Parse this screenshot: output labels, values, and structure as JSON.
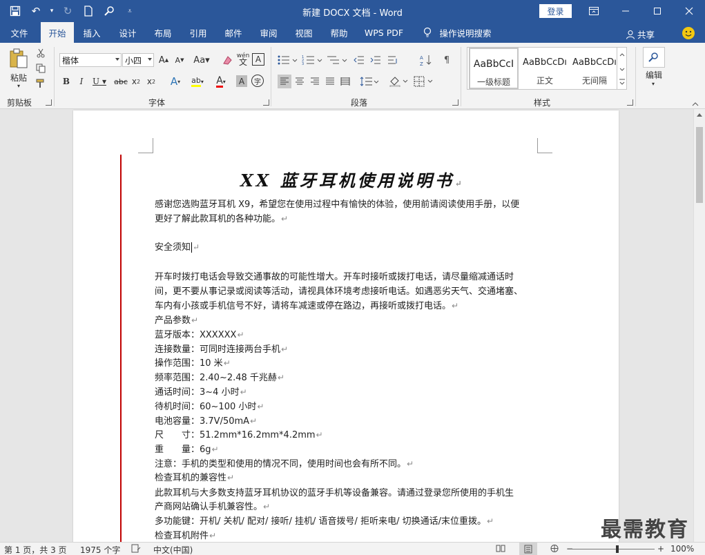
{
  "window": {
    "title": "新建 DOCX 文档 - Word",
    "login_label": "登录",
    "controls": [
      "🗗",
      "─",
      "☐",
      "✕"
    ]
  },
  "qat": {
    "icons": [
      "save-icon",
      "undo-icon",
      "redo-icon",
      "new-doc-icon",
      "touch-mode-icon",
      "customize-icon"
    ]
  },
  "tabs": [
    "文件",
    "开始",
    "插入",
    "设计",
    "布局",
    "引用",
    "邮件",
    "审阅",
    "视图",
    "帮助",
    "WPS PDF"
  ],
  "active_tab": "开始",
  "tell_me": "操作说明搜索",
  "share_label": "共享",
  "ribbon": {
    "clipboard": {
      "paste_label": "粘贴",
      "group_label": "剪贴板"
    },
    "font": {
      "font_name": "楷体",
      "font_size": "小四",
      "group_label": "字体",
      "buttons": [
        "A^",
        "Aˇ",
        "Aa",
        "B",
        "I",
        "U",
        "abc",
        "x₂",
        "x²",
        "A",
        "ab",
        "A",
        "A",
        "字"
      ]
    },
    "paragraph": {
      "group_label": "段落"
    },
    "styles": {
      "group_label": "样式",
      "items": [
        {
          "sample": "AaBbCcI",
          "name": "一级标题"
        },
        {
          "sample": "AaBbCcDı",
          "name": "正文"
        },
        {
          "sample": "AaBbCcDı",
          "name": "无间隔"
        }
      ]
    },
    "editing": {
      "label": "编辑"
    }
  },
  "document": {
    "heading": "XX 蓝牙耳机使用说明书",
    "lines": [
      {
        "text": "感谢您选购蓝牙耳机 X9，希望您在使用过程中有愉快的体验，使用前请阅读使用手册，以便",
        "pmark": ""
      },
      {
        "text": "更好了解此款耳机的各种功能。",
        "pmark": "↵"
      },
      {
        "text": "安全须知",
        "pmark": "↵"
      },
      {
        "text": "开车时拨打电话会导致交通事故的可能性增大。开车时接听或拨打电话，请尽量缩减通话时",
        "pmark": ""
      },
      {
        "text": "间，更不要从事记录或阅读等活动，请视具体环境考虑接听电话。如遇恶劣天气、交通堵塞、",
        "pmark": ""
      },
      {
        "text": "车内有小孩或手机信号不好，请将车减速或停在路边，再接听或拨打电话。",
        "pmark": "↵"
      },
      {
        "text": "产品参数",
        "pmark": "↵"
      },
      {
        "text": "蓝牙版本：XXXXXX",
        "pmark": "↵"
      },
      {
        "text": "连接数量：可同时连接两台手机",
        "pmark": "↵"
      },
      {
        "text": "操作范围：10 米",
        "pmark": "↵"
      },
      {
        "text": "频率范围：2.40~2.48 千兆赫",
        "pmark": "↵"
      },
      {
        "text": "通话时间：3~4 小时",
        "pmark": "↵"
      },
      {
        "text": "待机时间：60~100 小时",
        "pmark": "↵"
      },
      {
        "text": "电池容量：3.7V/50mA",
        "pmark": "↵"
      },
      {
        "text": "尺　　寸：51.2mm*16.2mm*4.2mm",
        "pmark": "↵"
      },
      {
        "text": "重　　量：6g",
        "pmark": "↵"
      },
      {
        "text": "注意：手机的类型和使用的情况不同，使用时间也会有所不同。",
        "pmark": "↵"
      },
      {
        "text": "检查耳机的兼容性",
        "pmark": "↵"
      },
      {
        "text": "此款耳机与大多数支持蓝牙耳机协议的蓝牙手机等设备兼容。请通过登录您所使用的手机生",
        "pmark": ""
      },
      {
        "text": "产商网站确认手机兼容性。",
        "pmark": "↵"
      },
      {
        "text": "多功能键：开机/ 关机/ 配对/ 接听/ 挂机/ 语音拨号/ 拒听来电/ 切换通话/末位重拨。",
        "pmark": "↵"
      },
      {
        "text": "检查耳机附件",
        "pmark": "↵"
      }
    ]
  },
  "watermark": "最需教育",
  "statusbar": {
    "page": "第 1 页，共 3 页",
    "words": "1975 个字",
    "language": "中文(中国)",
    "zoom": "100%"
  }
}
